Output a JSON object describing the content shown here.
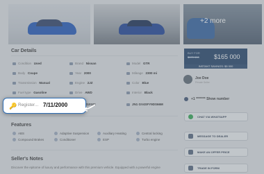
{
  "gallery": {
    "more_label": "+2 more"
  },
  "car_details": {
    "title": "Car Details",
    "specs": [
      {
        "label": "Condition",
        "value": "Used"
      },
      {
        "label": "Brand",
        "value": "Nissan"
      },
      {
        "label": "Model",
        "value": "GTR"
      },
      {
        "label": "Body",
        "value": "Coupe"
      },
      {
        "label": "Year",
        "value": "2000"
      },
      {
        "label": "Mileage",
        "value": "2300 mi"
      },
      {
        "label": "Transmission",
        "value": "Manual"
      },
      {
        "label": "Engine",
        "value": "2JZ"
      },
      {
        "label": "Color",
        "value": "Blue"
      },
      {
        "label": "Fuel type",
        "value": "Gasoline"
      },
      {
        "label": "Drive",
        "value": "AWD"
      },
      {
        "label": "Interior",
        "value": "Black"
      },
      {
        "label": "Stock",
        "value": "010101"
      },
      {
        "label": "",
        "value": "JN1 GV4SFY9DS66M"
      }
    ]
  },
  "popup": {
    "label": "Register...",
    "value": "7/11/2000"
  },
  "features": {
    "title": "Features",
    "items": [
      "ABS",
      "Adaptive Suspension",
      "Auxiliary Heating",
      "Central locking",
      "Compound Brakes",
      "Conditioner",
      "ESP",
      "Turbo engine"
    ]
  },
  "notes": {
    "title": "Seller's Notes",
    "text": "Discover the epitome of luxury and performance with this premium vehicle. Equipped with a powerful engine"
  },
  "price": {
    "buy_label": "BUY FOR",
    "old_price": "$170 000",
    "price": "$165 000",
    "savings": "INSTANT SAVINGS: $5 000"
  },
  "seller": {
    "name": "Joe Doe",
    "subtitle": "Private Seller",
    "phone": "+1 ******* Show number"
  },
  "buttons": [
    "CHAT VIA WHATSAPP",
    "MESSAGE TO DEALER",
    "MAKE AN OFFER PRICE",
    "TRADE IN FORM"
  ],
  "colors": {
    "accent": "#1f3f66",
    "popup_border": "#2d6db5",
    "whatsapp": "#2fa552"
  }
}
